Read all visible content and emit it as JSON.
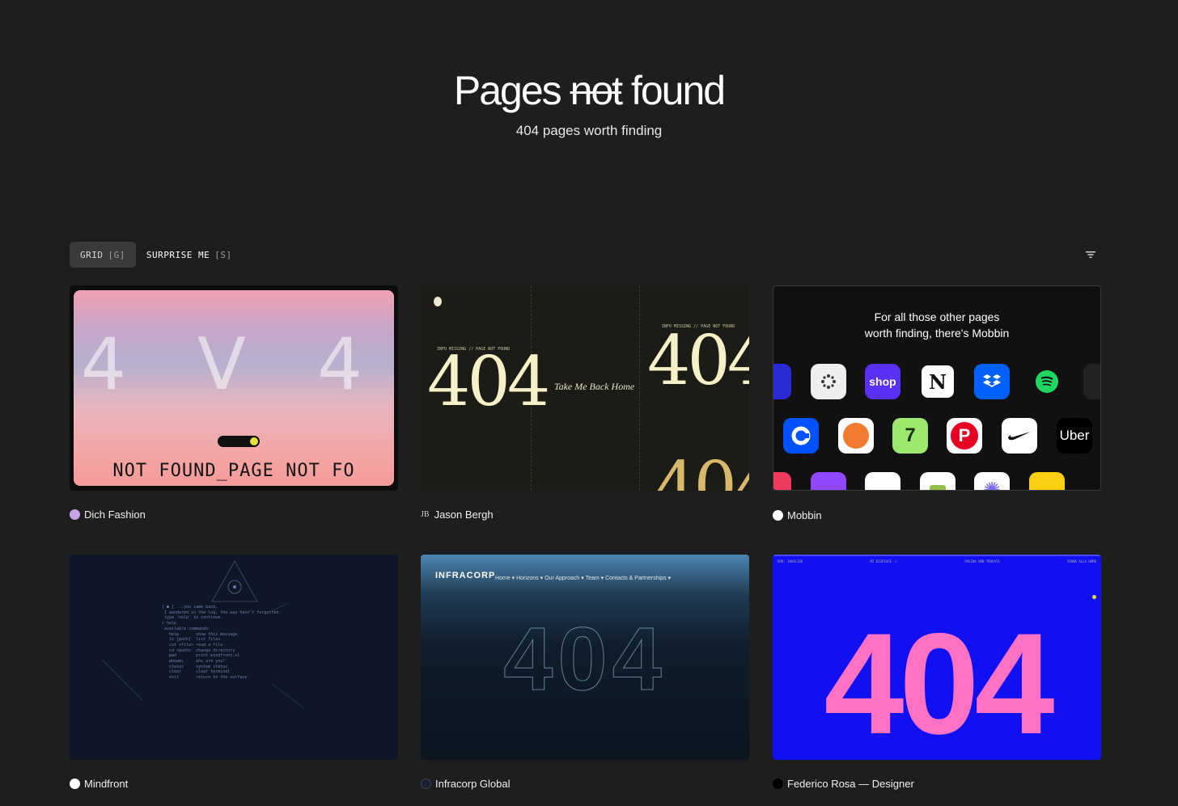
{
  "hero": {
    "title_pre": "Pages",
    "title_strike": "not",
    "title_post": "found",
    "subtitle": "404 pages worth finding"
  },
  "toolbar": {
    "grid_label": "GRID",
    "grid_key": "[G]",
    "surprise_label": "SURPRISE ME",
    "surprise_key": "[S]"
  },
  "cards": [
    {
      "name": "Dich Fashion",
      "thumb_number": "4 V 4",
      "thumb_ticker": "NOT FOUND_PAGE NOT FO"
    },
    {
      "name": "Jason Bergh",
      "initials": "JB",
      "thumb_number": "404",
      "thumb_link": "Take Me Back Home",
      "thumb_caption": "INFO MISSING // PAGE NOT FOUND"
    },
    {
      "name": "Mobbin",
      "thumb_title_line1": "For all those other pages",
      "thumb_title_line2": "worth finding, there's Mobbin",
      "apps": [
        "shop",
        "N",
        "Uber"
      ]
    },
    {
      "name": "Mindfront",
      "thumb_terminal": "[ ● ] ...you came back.\n I wandered in the log, the way hasn't forgotten.\n type 'help' to continue.\n> help\n available commands:\n   help       show this message\n   ls [path]  list files\n   cat <file> read a file\n   cd <path>  change directory\n   pwd        print mindfront.sl\n   whoami     who are you?\n   status     system status\n   clear      clear terminal\n   exit       return to the surface"
    },
    {
      "name": "Infracorp Global",
      "thumb_logo": "INFRACORP",
      "thumb_nav": "Home ▾    Horizons ▾    Our Approach ▾    Team ▾    Contacts & Partnerships ▾",
      "thumb_number": "404"
    },
    {
      "name": "Federico Rosa — Designer",
      "thumb_number": "404",
      "thumb_bar_left": "ERR: INVALIDO",
      "thumb_bar_mid": "MI DISPIACE :(",
      "thumb_bar_mid2": "PAGINA NON TROVATA",
      "thumb_bar_right": "TORNA ALLA HOME"
    }
  ]
}
